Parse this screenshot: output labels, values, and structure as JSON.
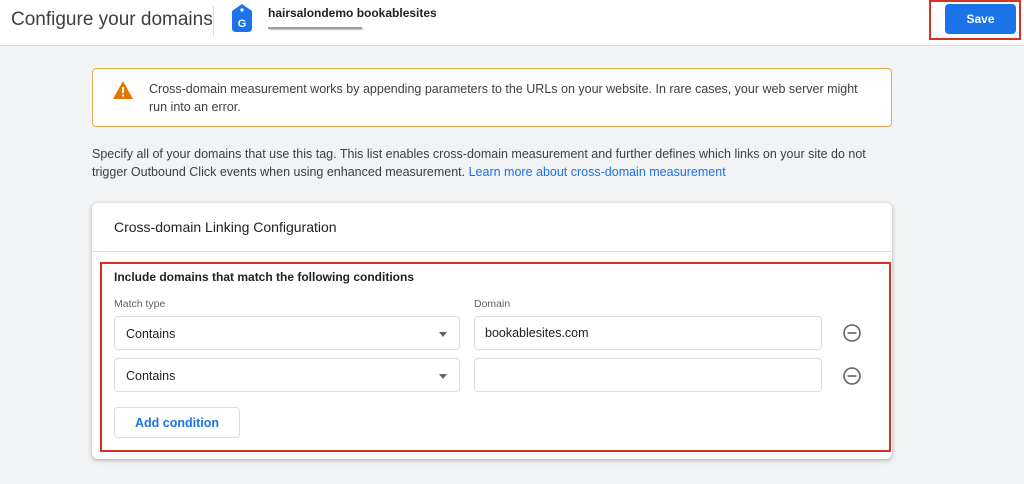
{
  "header": {
    "title": "Configure your domains",
    "tag_name": "hairsalondemo bookablesites",
    "save_label": "Save"
  },
  "warning": {
    "text": "Cross-domain measurement works by appending parameters to the URLs on your website. In rare cases, your web server might run into an error."
  },
  "description": {
    "text": "Specify all of your domains that use this tag. This list enables cross-domain measurement and further defines which links on your site do not trigger Outbound Click events when using enhanced measurement. ",
    "link_text": "Learn more about cross-domain measurement"
  },
  "card": {
    "title": "Cross-domain Linking Configuration",
    "conditions_heading": "Include domains that match the following conditions",
    "match_type_label": "Match type",
    "domain_label": "Domain",
    "rows": [
      {
        "match_type": "Contains",
        "domain": "bookablesites.com"
      },
      {
        "match_type": "Contains",
        "domain": ""
      }
    ],
    "add_condition_label": "Add condition"
  },
  "colors": {
    "primary": "#1a73e8",
    "warning_border": "#e8a951",
    "warning_icon": "#e37400",
    "highlight": "#d93025"
  }
}
